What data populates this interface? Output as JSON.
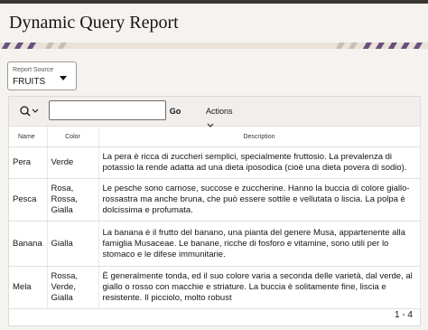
{
  "page": {
    "title": "Dynamic Query Report"
  },
  "controls": {
    "report_source_label": "Report Source",
    "report_source_value": "FRUITS"
  },
  "toolbar": {
    "search_icon": "search-icon",
    "search_value": "",
    "go_label": "Go",
    "actions_label": "Actions"
  },
  "table": {
    "headers": [
      "Name",
      "Color",
      "Description"
    ],
    "rows": [
      {
        "name": "Pera",
        "color": "Verde",
        "description": "La pera è ricca di zuccheri semplici, specialmente fruttosio. La prevalenza di potassio la rende adatta ad una dieta iposodica (cioè una dieta povera di sodio)."
      },
      {
        "name": "Pesca",
        "color": "Rosa, Rossa, Gialla",
        "description": "Le pesche sono carnose, succose e zuccherine. Hanno la buccia di colore giallo-rossastra ma anche bruna, che può essere sottile e vellutata o liscia. La polpa è dolcissima e profumata."
      },
      {
        "name": "Banana",
        "color": "Gialla",
        "description": "La banana è il frutto del banano, una pianta del genere Musa, appartenente alla famiglia Musaceae. Le banane, ricche di fosforo e vitamine, sono utili per lo stomaco e le difese immunitarie."
      },
      {
        "name": "Mela",
        "color": "Rossa, Verde, Gialla",
        "description": "È generalmente tonda, ed il suo colore varia a seconda delle varietà, dal verde, al giallo o rosso con macchie e striature. La buccia è solitamente fine, liscia e resistente. Il picciolo, molto robust"
      }
    ]
  },
  "pagination": "1 - 4"
}
